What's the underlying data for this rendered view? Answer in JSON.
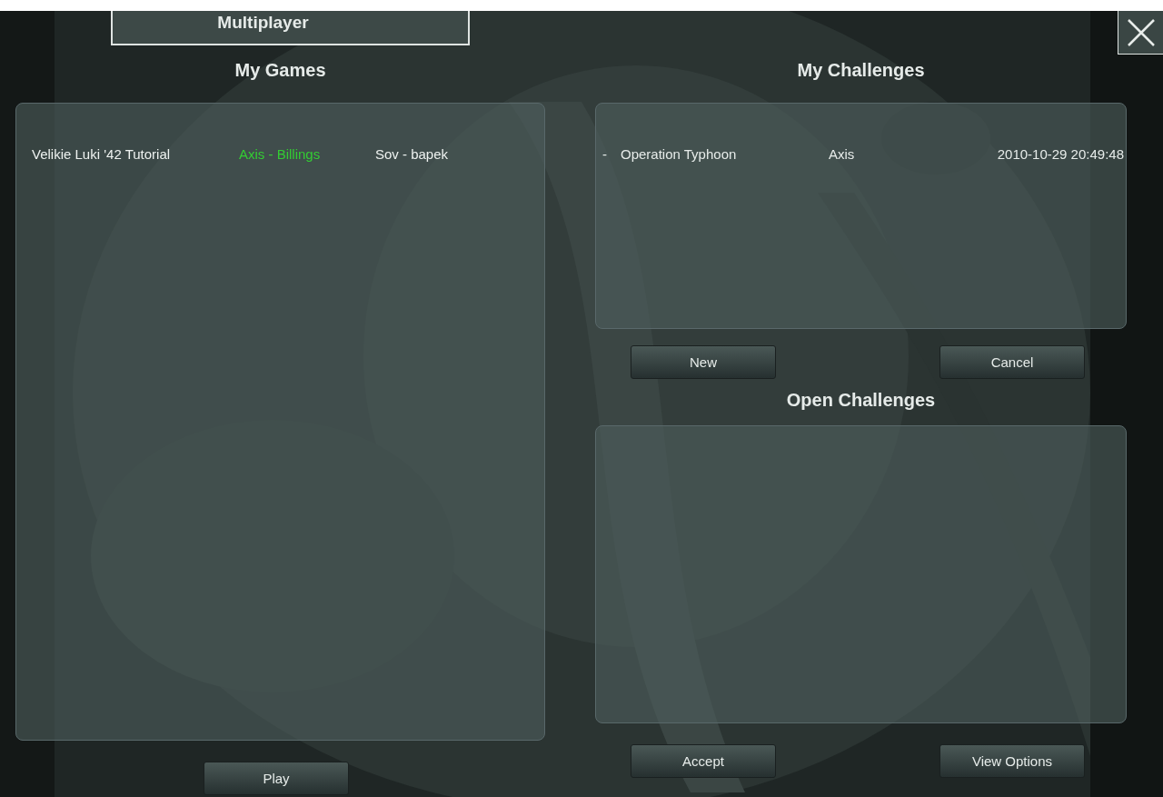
{
  "tab": {
    "label": "Multiplayer"
  },
  "my_games": {
    "title": "My Games",
    "rows": [
      {
        "cells": [
          {
            "text": "Velikie Luki '42 Tutorial",
            "highlighted": false
          },
          {
            "text": "Axis - Billings",
            "highlighted": true
          },
          {
            "text": "Sov - bapek",
            "highlighted": false
          }
        ]
      }
    ],
    "buttons": [
      "Play"
    ]
  },
  "my_challenges": {
    "title": "My Challenges",
    "rows": [
      {
        "marker": "-",
        "scenario": "Operation Typhoon",
        "side": "Axis",
        "date": "2010-10-29 20:49:48"
      }
    ],
    "buttons": [
      "New",
      "Cancel"
    ]
  },
  "open_challenges": {
    "title": "Open Challenges",
    "buttons": [
      "Accept",
      "View Options"
    ]
  }
}
